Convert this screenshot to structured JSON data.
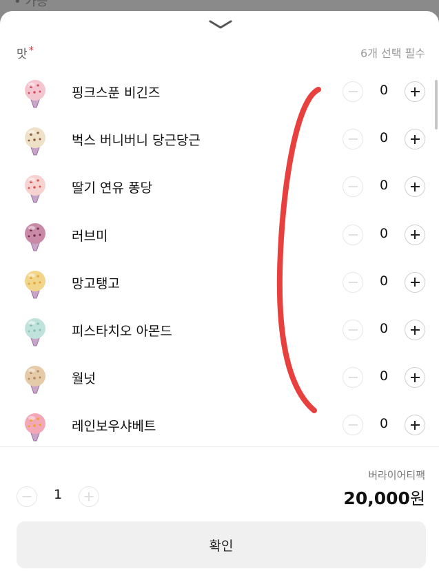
{
  "backdrop": {
    "text": "• 가능"
  },
  "section": {
    "title": "맛",
    "required_mark": "*",
    "hint": "6개 선택 필수"
  },
  "flavors": [
    {
      "name": "핑크스푼 비긴즈",
      "qty": "0",
      "scoop_color": "#f3c6cf",
      "dot_color": "#d8485e"
    },
    {
      "name": "벅스 버니버니 당근당근",
      "qty": "0",
      "scoop_color": "#efe0c8",
      "dot_color": "#8a5a3a"
    },
    {
      "name": "딸기 연유 퐁당",
      "qty": "0",
      "scoop_color": "#f6d3d0",
      "dot_color": "#e05050"
    },
    {
      "name": "러브미",
      "qty": "0",
      "scoop_color": "#c98aa8",
      "dot_color": "#7a2e4a"
    },
    {
      "name": "망고탱고",
      "qty": "0",
      "scoop_color": "#f1d58a",
      "dot_color": "#e0a534"
    },
    {
      "name": "피스타치오 아몬드",
      "qty": "0",
      "scoop_color": "#bfe3dc",
      "dot_color": "#8cbcb2"
    },
    {
      "name": "월넛",
      "qty": "0",
      "scoop_color": "#e6cba8",
      "dot_color": "#b48a5e"
    },
    {
      "name": "레인보우샤베트",
      "qty": "0",
      "scoop_color": "#f3a8b8",
      "dot_color": "#f0a020"
    }
  ],
  "footer": {
    "quantity": "1",
    "product_name": "버라이어티팩",
    "price": "20,000",
    "currency": "원",
    "confirm_label": "확인"
  },
  "colors": {
    "accent_required": "#f23b3b",
    "annotation": "#e8403e",
    "button_bg": "#f0f0f0"
  }
}
